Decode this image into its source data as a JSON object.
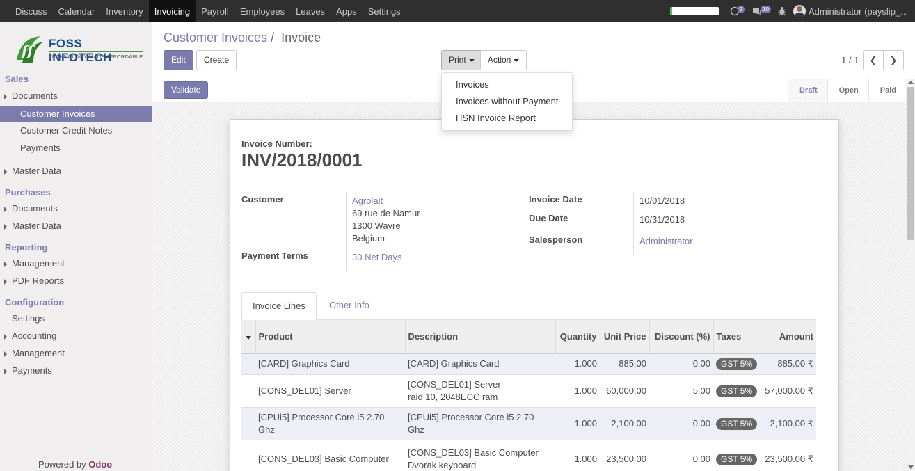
{
  "topbar": {
    "menu": [
      "Discuss",
      "Calendar",
      "Inventory",
      "Invoicing",
      "Payroll",
      "Employees",
      "Leaves",
      "Apps",
      "Settings"
    ],
    "active": "Invoicing",
    "progress_fraction": 0.05,
    "chat_count": "2",
    "message_count": "10",
    "user": "Administrator (payslip_..."
  },
  "sidebar": {
    "logo": {
      "name": "FOSS INFOTECH",
      "tagline": "TECHNOLOGY MADE AFFORDABLE"
    },
    "sections": {
      "sales": "Sales",
      "purchases": "Purchases",
      "reporting": "Reporting",
      "configuration": "Configuration"
    },
    "items": {
      "sales_documents": "Documents",
      "customer_invoices": "Customer Invoices",
      "customer_credit_notes": "Customer Credit Notes",
      "payments": "Payments",
      "sales_master_data": "Master Data",
      "purchases_documents": "Documents",
      "purchases_master_data": "Master Data",
      "management": "Management",
      "pdf_reports": "PDF Reports",
      "settings": "Settings",
      "accounting": "Accounting",
      "config_management": "Management",
      "config_payments": "Payments"
    },
    "powered_by": "Powered by",
    "powered_brand": "Odoo"
  },
  "control": {
    "breadcrumb_parent": "Customer Invoices",
    "breadcrumb_sep": "/",
    "breadcrumb_current": "Invoice",
    "edit": "Edit",
    "create": "Create",
    "print": "Print",
    "action": "Action",
    "pager": "1 / 1",
    "print_menu": [
      "Invoices",
      "Invoices without Payment",
      "HSN Invoice Report"
    ]
  },
  "status": {
    "validate": "Validate",
    "states": [
      "Draft",
      "Open",
      "Paid"
    ],
    "current": "Draft"
  },
  "invoice": {
    "number_label": "Invoice Number:",
    "number": "INV/2018/0001",
    "customer_label": "Customer",
    "customer_name": "Agrolait",
    "address1": "69 rue de Namur",
    "address2": "1300 Wavre",
    "address3": "Belgium",
    "payment_terms_label": "Payment Terms",
    "payment_terms": "30 Net Days",
    "invoice_date_label": "Invoice Date",
    "invoice_date": "10/01/2018",
    "due_date_label": "Due Date",
    "due_date": "10/31/2018",
    "salesperson_label": "Salesperson",
    "salesperson": "Administrator"
  },
  "tabs": {
    "lines": "Invoice Lines",
    "other": "Other Info"
  },
  "table": {
    "headers": {
      "product": "Product",
      "description": "Description",
      "quantity": "Quantity",
      "unit_price": "Unit Price",
      "discount": "Discount (%)",
      "taxes": "Taxes",
      "amount": "Amount"
    },
    "rows": [
      {
        "product": "[CARD] Graphics Card",
        "desc1": "[CARD] Graphics Card",
        "desc2": "",
        "qty": "1.000",
        "price": "885.00",
        "discount": "0.00",
        "tax": "GST 5%",
        "amount": "885.00 ₹"
      },
      {
        "product": "[CONS_DEL01] Server",
        "desc1": "[CONS_DEL01] Server",
        "desc2": "raid 10, 2048ECC ram",
        "qty": "1.000",
        "price": "60,000.00",
        "discount": "5.00",
        "tax": "GST 5%",
        "amount": "57,000.00 ₹"
      },
      {
        "product": "[CPUi5] Processor Core i5 2.70 Ghz",
        "desc1": "[CPUi5] Processor Core i5 2.70",
        "desc2": "Ghz",
        "qty": "1.000",
        "price": "2,100.00",
        "discount": "0.00",
        "tax": "GST 5%",
        "amount": "2,100.00 ₹"
      },
      {
        "product": "[CONS_DEL03] Basic Computer",
        "desc1": "[CONS_DEL03] Basic Computer",
        "desc2": "Dvorak keyboard",
        "qty": "1.000",
        "price": "23,500.00",
        "discount": "0.00",
        "tax": "GST 5%",
        "amount": "23,500.00 ₹"
      }
    ]
  },
  "colors": {
    "brand": "#7c7bad",
    "topbar": "#2f2f2f",
    "sidebar": "#f0eeee"
  }
}
